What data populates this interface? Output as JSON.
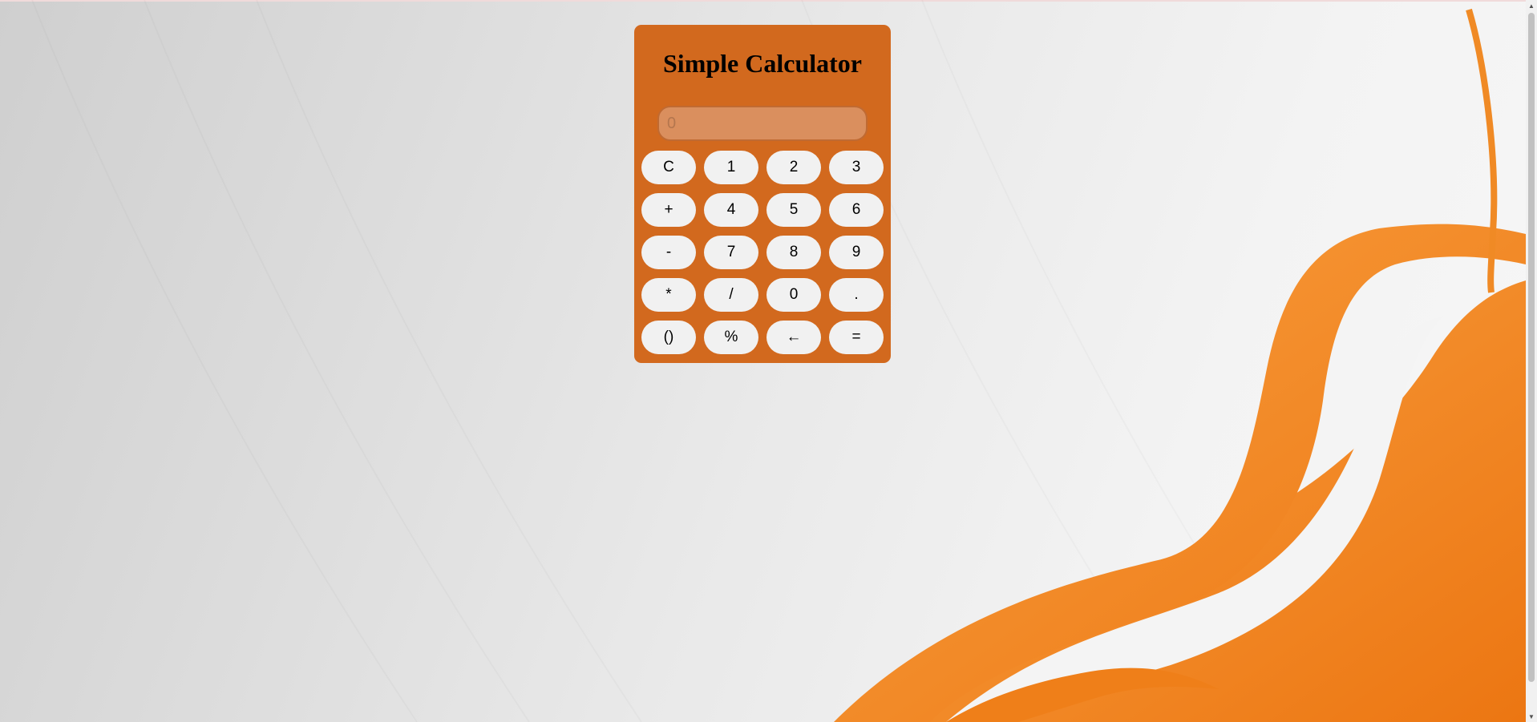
{
  "calculator": {
    "title": "Simple Calculator",
    "display": {
      "value": "",
      "placeholder": "0"
    },
    "keys": [
      {
        "label": "C",
        "name": "clear-button"
      },
      {
        "label": "1",
        "name": "digit-1-button"
      },
      {
        "label": "2",
        "name": "digit-2-button"
      },
      {
        "label": "3",
        "name": "digit-3-button"
      },
      {
        "label": "+",
        "name": "add-button"
      },
      {
        "label": "4",
        "name": "digit-4-button"
      },
      {
        "label": "5",
        "name": "digit-5-button"
      },
      {
        "label": "6",
        "name": "digit-6-button"
      },
      {
        "label": "-",
        "name": "subtract-button"
      },
      {
        "label": "7",
        "name": "digit-7-button"
      },
      {
        "label": "8",
        "name": "digit-8-button"
      },
      {
        "label": "9",
        "name": "digit-9-button"
      },
      {
        "label": "*",
        "name": "multiply-button"
      },
      {
        "label": "/",
        "name": "divide-button"
      },
      {
        "label": "0",
        "name": "digit-0-button"
      },
      {
        "label": ".",
        "name": "decimal-button"
      },
      {
        "label": "()",
        "name": "parentheses-button"
      },
      {
        "label": "%",
        "name": "percent-button"
      },
      {
        "label": "←",
        "name": "backspace-button"
      },
      {
        "label": "=",
        "name": "equals-button"
      }
    ]
  },
  "colors": {
    "panel": "#d2691e",
    "display": "#da8f5e",
    "key": "#f1f1f1",
    "accent_wave": "#f28a1f"
  },
  "scrollbar": {
    "up_icon": "triangle-up-icon",
    "down_icon": "triangle-down-icon"
  }
}
